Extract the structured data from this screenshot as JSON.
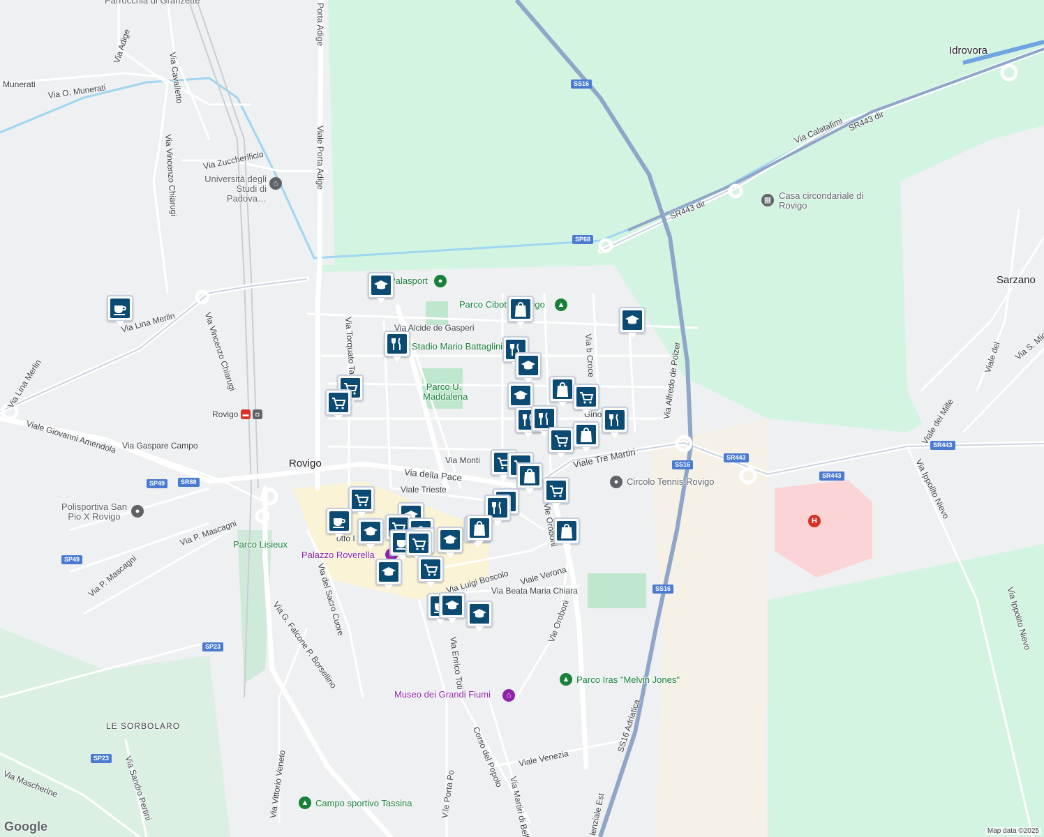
{
  "map": {
    "town_labels": [
      {
        "id": "rovigo",
        "text": "Rovigo"
      },
      {
        "id": "idrovora",
        "text": "Idrovora"
      },
      {
        "id": "sarzano",
        "text": "Sarzano"
      },
      {
        "id": "le-sorbolaro",
        "text": "LE SORBOLARO"
      },
      {
        "id": "rovigo-station",
        "text": "Rovigo"
      }
    ],
    "street_labels": [
      "Via Adige",
      "Via O. Munerati",
      "Munerati",
      "Via Cavalletto",
      "Via Vincenzo Chiarugi",
      "Via Zuccherificio",
      "Porta Adige",
      "Viale Porta Adige",
      "Via Lina Merlin",
      "Via Lina Merlin",
      "Via Vincenzo Chiarugi",
      "Viale Giovanni Amendola",
      "Via Gaspare Campo",
      "Via P. Mascagni",
      "Via P. Mascagni",
      "Via Torquato Tasso",
      "Via Alcide de Gasperi",
      "Via Monti",
      "Via della Pace",
      "Viale Trieste",
      "Viale Tre Martiri",
      "Via Alfredo de Polzer",
      "Via b Croce",
      "Via Luigi Boscolo",
      "Viale Verona",
      "Via Beata Maria Chiara",
      "Vle Oroboni",
      "Vle Oroboni",
      "Via del Sacro Cuore",
      "Via G. Falcone P. Borsellino",
      "Via Enrico Toti",
      "Corso del Popolo",
      "V.le Porta Po",
      "Via Vittorio Veneto",
      "Via Sandro Pertini",
      "Via Mascherine",
      "Viale Venezia",
      "Via Martiri di Belfiore",
      "SS16 Adriatica",
      "Via Calatafimi",
      "SR443 dir",
      "SR443 dir",
      "Viale dei Mille",
      "Via Ippolito Nievo",
      "Via Ippolito Nievo",
      "Via S. Mich",
      "Viale del",
      "Gino P",
      "lenziale Est",
      "otto I"
    ],
    "place_labels": [
      {
        "id": "universita",
        "text": "Università degli Studi di Padova…",
        "kind": "poi",
        "icon": "graduation-cap-icon"
      },
      {
        "id": "palasport",
        "text": "Palasport",
        "kind": "green",
        "icon": "park-pin-icon"
      },
      {
        "id": "parco-cibotto",
        "text": "Parco Cibotto Rovigo",
        "kind": "green",
        "icon": "tree-icon"
      },
      {
        "id": "stadio",
        "text": "Stadio Mario Battaglini",
        "kind": "green",
        "icon": "park-pin-icon"
      },
      {
        "id": "parco-maddalena",
        "text": "Parco U. Maddalena",
        "kind": "green",
        "icon": ""
      },
      {
        "id": "casa-circondariale",
        "text": "Casa circondariale di Rovigo",
        "kind": "poi",
        "icon": "building-icon"
      },
      {
        "id": "polisportiva",
        "text": "Polisportiva San Pio X Rovigo",
        "kind": "poi",
        "icon": "pin-icon"
      },
      {
        "id": "circolo-tennis",
        "text": "Circolo Tennis Rovigo",
        "kind": "poi",
        "icon": "pin-icon"
      },
      {
        "id": "parco-lisieux",
        "text": "Parco Lisieux",
        "kind": "green",
        "icon": ""
      },
      {
        "id": "palazzo-roverella",
        "text": "Palazzo Roverella",
        "kind": "purple",
        "icon": "museum-icon"
      },
      {
        "id": "museo-grandi-fiumi",
        "text": "Museo dei Grandi Fiumi",
        "kind": "purple",
        "icon": "museum-icon"
      },
      {
        "id": "parco-iras",
        "text": "Parco Iras \"Melvin Jones\"",
        "kind": "green",
        "icon": "tree-icon"
      },
      {
        "id": "campo-tassina",
        "text": "Campo sportivo Tassina",
        "kind": "green",
        "icon": "tree-icon"
      },
      {
        "id": "parrocchia",
        "text": "Parrocchia di Granzette",
        "kind": "poi",
        "icon": "pin-icon"
      }
    ],
    "road_shields": [
      "SS16",
      "SP68",
      "SR443 dir",
      "SS16",
      "SR443",
      "SR443",
      "SR443",
      "SS16",
      "SP49",
      "SR88",
      "SP49",
      "SP23",
      "SP23"
    ],
    "markers": [
      {
        "type": "education"
      },
      {
        "type": "coffee"
      },
      {
        "type": "shopping"
      },
      {
        "type": "education"
      },
      {
        "type": "restaurant"
      },
      {
        "type": "restaurant"
      },
      {
        "type": "education"
      },
      {
        "type": "grocery"
      },
      {
        "type": "grocery"
      },
      {
        "type": "shopping"
      },
      {
        "type": "education"
      },
      {
        "type": "grocery"
      },
      {
        "type": "restaurant"
      },
      {
        "type": "restaurant"
      },
      {
        "type": "restaurant"
      },
      {
        "type": "grocery"
      },
      {
        "type": "shopping"
      },
      {
        "type": "grocery"
      },
      {
        "type": "grocery"
      },
      {
        "type": "shopping"
      },
      {
        "type": "grocery"
      },
      {
        "type": "restaurant"
      },
      {
        "type": "restaurant"
      },
      {
        "type": "shopping"
      },
      {
        "type": "grocery"
      },
      {
        "type": "coffee"
      },
      {
        "type": "education"
      },
      {
        "type": "education"
      },
      {
        "type": "grocery"
      },
      {
        "type": "education"
      },
      {
        "type": "grocery"
      },
      {
        "type": "coffee"
      },
      {
        "type": "grocery"
      },
      {
        "type": "education"
      },
      {
        "type": "shopping"
      },
      {
        "type": "shopping"
      },
      {
        "type": "education"
      },
      {
        "type": "grocery"
      },
      {
        "type": "coffee"
      },
      {
        "type": "education"
      },
      {
        "type": "education"
      }
    ],
    "attribution": "Map data ©2025",
    "logo": "Google",
    "colors": {
      "green_area": "#d4f4e2",
      "road_major": "#8fa6c8",
      "water": "#9fd6f0",
      "hospital": "#fbd5d5",
      "marker_fill": "#0b4a73"
    }
  }
}
